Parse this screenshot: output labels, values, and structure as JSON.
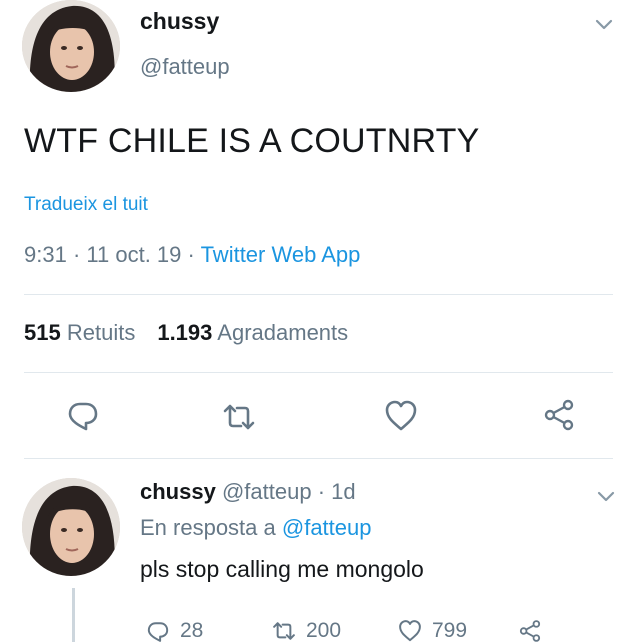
{
  "tweet": {
    "author_name": "chussy",
    "author_handle": "@fatteup",
    "text": "WTF CHILE IS A COUTNRTY",
    "translate_link": "Tradueix el tuit",
    "time": "9:31",
    "separator": "·",
    "date": "11 oct. 19",
    "source": "Twitter Web App",
    "retweet_count": "515",
    "retweet_label": "Retuits",
    "like_count": "1.193",
    "like_label": "Agradaments"
  },
  "reply": {
    "author_name": "chussy",
    "author_handle": "@fatteup",
    "separator": "·",
    "age": "1d",
    "replying_to_label": "En resposta a",
    "replying_to_handle": "@fatteup",
    "text": "pls stop calling me mongolo",
    "reply_count": "28",
    "retweet_count": "200",
    "like_count": "799"
  },
  "colors": {
    "text": "#14171a",
    "secondary": "#657786",
    "link": "#1b95e0",
    "divider": "#e1e8ed"
  },
  "icons": [
    "chevron-down-icon",
    "reply-icon",
    "retweet-icon",
    "like-icon",
    "share-icon"
  ]
}
